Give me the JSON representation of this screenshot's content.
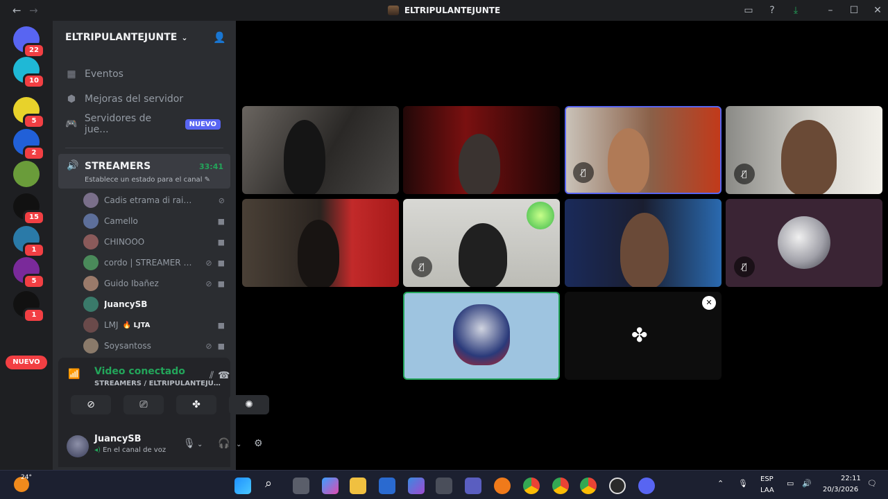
{
  "window": {
    "title": "ELTRIPULANTEJUNTE"
  },
  "rail": {
    "items": [
      {
        "name": "home",
        "badge": "22",
        "color": "#5865f2"
      },
      {
        "name": "server-1",
        "badge": "10",
        "color": "#1fb8d6"
      },
      {
        "name": "server-2",
        "badge": "5",
        "color": "#e8d22b"
      },
      {
        "name": "server-3",
        "badge": "2",
        "color": "#2160d8"
      },
      {
        "name": "server-4",
        "badge": "",
        "color": "#6a9c3a"
      },
      {
        "name": "server-5",
        "badge": "15",
        "color": "#111111"
      },
      {
        "name": "server-6",
        "badge": "1",
        "color": "#2a7aa8"
      },
      {
        "name": "server-7",
        "badge": "5",
        "color": "#7a2a9a"
      },
      {
        "name": "server-8",
        "badge": "1",
        "color": "#111111"
      }
    ],
    "nuevo_label": "NUEVO"
  },
  "sidebar": {
    "server_name": "ELTRIPULANTEJUNTE",
    "nav": [
      {
        "icon": "calendar-icon",
        "glyph": "▦",
        "label": "Eventos"
      },
      {
        "icon": "boost-icon",
        "glyph": "⬢",
        "label": "Mejoras del servidor"
      },
      {
        "icon": "gamepad-icon",
        "glyph": "🎮",
        "label": "Servidores de jue...",
        "badge": "NUEVO"
      }
    ],
    "voice_channel": {
      "name": "STREAMERS",
      "timer": "33:41",
      "status": "Establece un estado para el canal"
    },
    "members": [
      {
        "name": "Cadis etrama di raizel",
        "color": "#7a6f8a",
        "muted": true,
        "cam": false
      },
      {
        "name": "Camello",
        "color": "#5d6f9a",
        "muted": false,
        "cam": true
      },
      {
        "name": "CHINOOO",
        "color": "#8a5a5a",
        "muted": false,
        "cam": true
      },
      {
        "name": "cordo | STREAMER | ...",
        "color": "#4a8a5a",
        "muted": true,
        "cam": true
      },
      {
        "name": "Guido Ibañez",
        "color": "#9a7a6a",
        "muted": true,
        "cam": true
      },
      {
        "name": "JuancySB",
        "color": "#3a7a6a",
        "muted": false,
        "cam": false
      },
      {
        "name": "LMJ",
        "tag": "🔥 LJTA",
        "color": "#6a4a4a",
        "muted": false,
        "cam": true
      },
      {
        "name": "Soysantoss",
        "color": "#8a7a6a",
        "muted": true,
        "cam": true
      }
    ]
  },
  "voice_panel": {
    "title": "Video conectado",
    "subtitle": "STREAMERS / ELTRIPULANTEJUNTE..."
  },
  "user_panel": {
    "name": "JuancySB",
    "status": "En el canal de voz"
  },
  "taskbar": {
    "temperature": "24°",
    "language": "ESP",
    "language_sub": "LAA",
    "time": "22:11",
    "date": "20/3/2026"
  }
}
